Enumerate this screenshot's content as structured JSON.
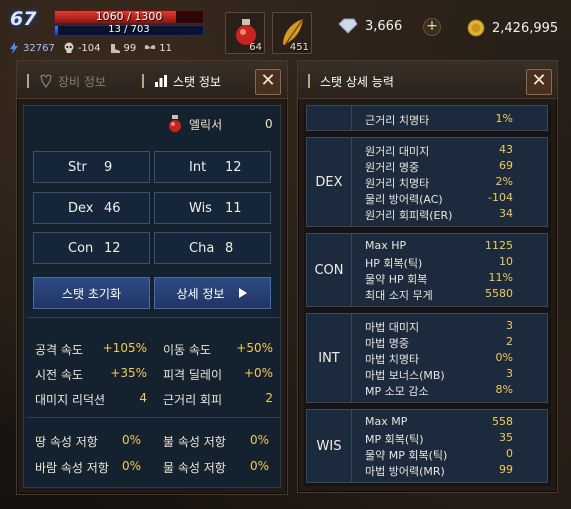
{
  "hud": {
    "level": "67",
    "hp_text": "1060 / 1300",
    "mp_text": "13 / 703",
    "hp_fraction": 0.815,
    "mp_fraction": 0.018,
    "small_stats": [
      "32767",
      "-104",
      "99",
      "11"
    ],
    "potion_count": "64",
    "item_count": "451",
    "diamond": "3,666",
    "plus": "+",
    "gold": "2,426,995"
  },
  "left_panel": {
    "tab_equipment": "장비 정보",
    "tab_stats": "스탯 정보",
    "close": "✕",
    "elixir_label": "엘릭서",
    "elixir_value": "0",
    "stats": [
      {
        "name": "Str",
        "value": "9"
      },
      {
        "name": "Int",
        "value": "12"
      },
      {
        "name": "Dex",
        "value": "46"
      },
      {
        "name": "Wis",
        "value": "11"
      },
      {
        "name": "Con",
        "value": "12"
      },
      {
        "name": "Cha",
        "value": "8"
      }
    ],
    "reset_button": "스탯 초기화",
    "detail_button": "상세 정보",
    "attributes": [
      {
        "label": "공격 속도",
        "value": "+105%"
      },
      {
        "label": "이동 속도",
        "value": "+50%"
      },
      {
        "label": "시전 속도",
        "value": "+35%"
      },
      {
        "label": "피격 딜레이",
        "value": "+0%"
      },
      {
        "label": "대미지 리덕션",
        "value": "4"
      },
      {
        "label": "근거리 회피",
        "value": "2"
      }
    ],
    "resists": [
      {
        "label": "땅 속성 저항",
        "value": "0%"
      },
      {
        "label": "불 속성 저항",
        "value": "0%"
      },
      {
        "label": "바람 속성 저항",
        "value": "0%"
      },
      {
        "label": "물 속성 저항",
        "value": "0%"
      }
    ]
  },
  "right_panel": {
    "title": "스탯 상세 능력",
    "close": "✕",
    "top_row": {
      "label": "근거리 치명타",
      "value": "1%"
    },
    "groups": [
      {
        "name": "DEX",
        "rows": [
          {
            "label": "원거리 대미지",
            "value": "43"
          },
          {
            "label": "원거리 명중",
            "value": "69"
          },
          {
            "label": "원거리 치명타",
            "value": "2%"
          },
          {
            "label": "물리 방어력(AC)",
            "value": "-104"
          },
          {
            "label": "원거리 회피력(ER)",
            "value": "34"
          }
        ]
      },
      {
        "name": "CON",
        "rows": [
          {
            "label": "Max HP",
            "value": "1125"
          },
          {
            "label": "HP 회복(틱)",
            "value": "10"
          },
          {
            "label": "물약 HP 회복",
            "value": "11%"
          },
          {
            "label": "최대 소지 무게",
            "value": "5580"
          }
        ]
      },
      {
        "name": "INT",
        "rows": [
          {
            "label": "마법 대미지",
            "value": "3"
          },
          {
            "label": "마법 명중",
            "value": "2"
          },
          {
            "label": "마법 치명타",
            "value": "0%"
          },
          {
            "label": "마법 보너스(MB)",
            "value": "3"
          },
          {
            "label": "MP 소모 감소",
            "value": "8%"
          }
        ]
      },
      {
        "name": "WIS",
        "rows": [
          {
            "label": "Max MP",
            "value": "558"
          },
          {
            "label": "MP 회복(틱)",
            "value": "35"
          },
          {
            "label": "물약 MP 회복(틱)",
            "value": "0"
          },
          {
            "label": "마법 방어력(MR)",
            "value": "99"
          }
        ]
      }
    ]
  },
  "icons": [
    "lightning-icon",
    "skull-icon",
    "shoe-icon",
    "wings-icon",
    "potion-icon",
    "feather-icon",
    "diamond-icon",
    "gold-coin-icon",
    "armor-icon",
    "chart-icon",
    "close-icon",
    "play-arrow-icon"
  ]
}
